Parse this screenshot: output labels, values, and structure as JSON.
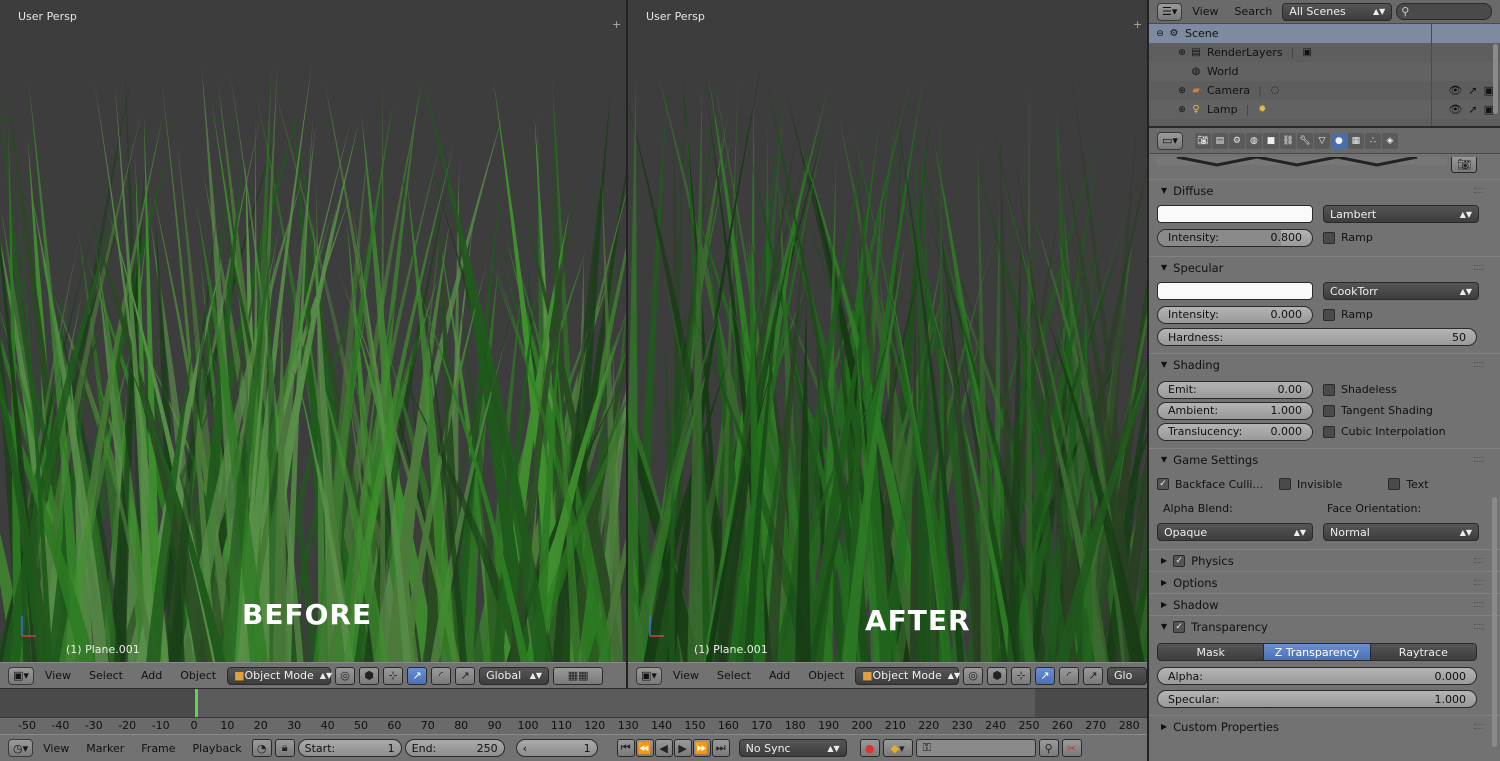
{
  "viewport_left": {
    "label": "User Persp",
    "object_label": "(1) Plane.001",
    "caption": "BEFORE"
  },
  "viewport_right": {
    "label": "User Persp",
    "object_label": "(1) Plane.001",
    "caption": "AFTER"
  },
  "view3d_header": {
    "menus": [
      "View",
      "Select",
      "Add",
      "Object"
    ],
    "mode": "Object Mode",
    "orientation": "Global",
    "orientation_right": "Glo"
  },
  "timeline": {
    "current_frame_marker": 0,
    "ticks": [
      "-50",
      "-40",
      "-30",
      "-20",
      "-10",
      "0",
      "10",
      "20",
      "30",
      "40",
      "50",
      "60",
      "70",
      "80",
      "90",
      "100",
      "110",
      "120",
      "130",
      "140",
      "150",
      "160",
      "170",
      "180",
      "190",
      "200",
      "210",
      "220",
      "230",
      "240",
      "250",
      "260",
      "270",
      "280"
    ]
  },
  "timeline_header": {
    "menus": [
      "View",
      "Marker",
      "Frame",
      "Playback"
    ],
    "start_label": "Start:",
    "start_value": "1",
    "end_label": "End:",
    "end_value": "250",
    "current_value": "1",
    "sync": "No Sync"
  },
  "outliner": {
    "menus": [
      "View",
      "Search"
    ],
    "scene_select": "All Scenes",
    "rows": [
      {
        "label": "Scene",
        "icon": "scene-icon",
        "selected": true
      },
      {
        "label": "RenderLayers",
        "icon": "renderlayers-icon"
      },
      {
        "label": "World",
        "icon": "world-icon"
      },
      {
        "label": "Camera",
        "icon": "camera-icon"
      },
      {
        "label": "Lamp",
        "icon": "lamp-icon"
      }
    ]
  },
  "material": {
    "diffuse": {
      "title": "Diffuse",
      "shader": "Lambert",
      "intensity_label": "Intensity:",
      "intensity": "0.800",
      "intensity_fraction": 0.8,
      "ramp": "Ramp"
    },
    "specular": {
      "title": "Specular",
      "shader": "CookTorr",
      "intensity_label": "Intensity:",
      "intensity": "0.000",
      "ramp": "Ramp",
      "hardness_label": "Hardness:",
      "hardness": "50"
    },
    "shading": {
      "title": "Shading",
      "emit_label": "Emit:",
      "emit": "0.00",
      "ambient_label": "Ambient:",
      "ambient": "1.000",
      "translucency_label": "Translucency:",
      "translucency": "0.000",
      "shadeless": "Shadeless",
      "tangent": "Tangent Shading",
      "cubic": "Cubic Interpolation"
    },
    "game": {
      "title": "Game Settings",
      "backface": "Backface Culli...",
      "invisible": "Invisible",
      "text": "Text",
      "alpha_blend_label": "Alpha Blend:",
      "alpha_blend": "Opaque",
      "face_orient_label": "Face Orientation:",
      "face_orient": "Normal"
    },
    "physics": "Physics",
    "options": "Options",
    "shadow": "Shadow",
    "transparency": {
      "title": "Transparency",
      "modes": [
        "Mask",
        "Z Transparency",
        "Raytrace"
      ],
      "active_mode": "Z Transparency",
      "alpha_label": "Alpha:",
      "alpha": "0.000",
      "specular_label": "Specular:",
      "specular": "1.000"
    },
    "custom_properties": "Custom Properties"
  }
}
